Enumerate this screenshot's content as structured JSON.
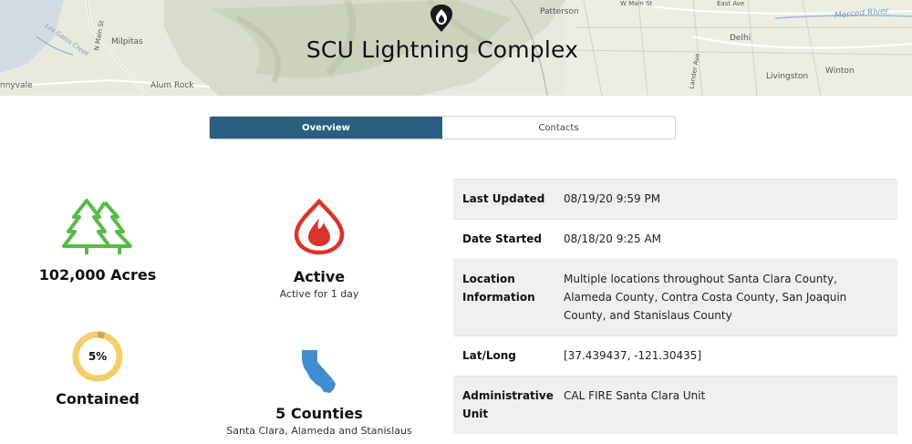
{
  "map": {
    "labels": {
      "milpitas": "Milpitas",
      "alum_rock": "Alum Rock",
      "sunnyvale": "nnyvale",
      "patterson": "Patterson",
      "w_main": "W Main St",
      "east_ave": "East Ave",
      "delhi": "Delhi",
      "livingston": "Livingston",
      "winton": "Winton",
      "merced_river": "Merced River",
      "los_gatos_creek": "Los Gatos Creek",
      "lander_ave": "Lander Ave",
      "n_main": "N Main St"
    }
  },
  "header": {
    "title": "SCU Lightning Complex"
  },
  "tabs": [
    {
      "label": "Overview",
      "active": true
    },
    {
      "label": "Contacts",
      "active": false
    }
  ],
  "stats": {
    "acres": {
      "value": "102,000 Acres",
      "icon": "trees-icon",
      "color": "#5ab94a"
    },
    "status": {
      "value": "Active",
      "sub": "Active for 1 day",
      "icon": "fire-icon",
      "color": "#d9342b"
    },
    "containment": {
      "percent_label": "5%",
      "percent": 5,
      "value": "Contained",
      "ring_color": "#f3cf6b",
      "fill_color": "#c9a93f"
    },
    "counties": {
      "value": "5 Counties",
      "sub": "Santa Clara, Alameda and Stanislaus",
      "icon": "california-icon",
      "color": "#3f8fd0"
    }
  },
  "info": [
    {
      "key": "Last Updated",
      "value": "08/19/20 9:59 PM"
    },
    {
      "key": "Date Started",
      "value": "08/18/20 9:25 AM"
    },
    {
      "key": "Location Information",
      "value": "Multiple locations throughout Santa Clara County, Alameda County, Contra Costa County, San Joaquin County, and Stanislaus County"
    },
    {
      "key": "Lat/Long",
      "value": "[37.439437, -121.30435]"
    },
    {
      "key": "Administrative Unit",
      "value": "CAL FIRE Santa Clara Unit"
    }
  ]
}
